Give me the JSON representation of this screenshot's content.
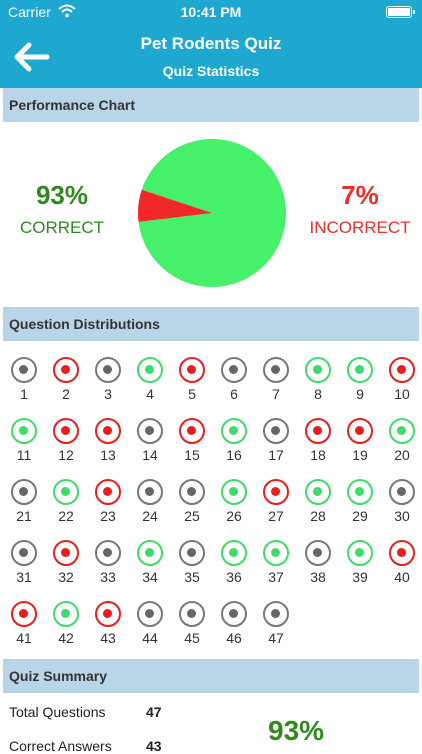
{
  "status_bar": {
    "carrier": "Carrier",
    "time": "10:41 PM"
  },
  "nav": {
    "title": "Pet Rodents Quiz",
    "subtitle": "Quiz Statistics",
    "back_icon": "back-arrow-icon"
  },
  "colors": {
    "header": "#1ea7cf",
    "section": "#b9d5e8",
    "correct": "#3ddc6a",
    "incorrect": "#e81d1d",
    "unanswered": "#777777",
    "correct_text": "#2e8a1e",
    "incorrect_text": "#e8302a"
  },
  "performance": {
    "header": "Performance Chart",
    "correct_pct": "93%",
    "correct_label": "CORRECT",
    "incorrect_pct": "7%",
    "incorrect_label": "INCORRECT"
  },
  "chart_data": {
    "type": "pie",
    "categories": [
      "Correct",
      "Incorrect"
    ],
    "values": [
      93,
      7
    ],
    "colors": [
      "#46f06b",
      "#f02828"
    ]
  },
  "distribution": {
    "header": "Question Distributions",
    "questions": [
      {
        "n": "1",
        "state": "unanswered"
      },
      {
        "n": "2",
        "state": "incorrect"
      },
      {
        "n": "3",
        "state": "unanswered"
      },
      {
        "n": "4",
        "state": "correct"
      },
      {
        "n": "5",
        "state": "incorrect"
      },
      {
        "n": "6",
        "state": "unanswered"
      },
      {
        "n": "7",
        "state": "unanswered"
      },
      {
        "n": "8",
        "state": "correct"
      },
      {
        "n": "9",
        "state": "correct"
      },
      {
        "n": "10",
        "state": "incorrect"
      },
      {
        "n": "11",
        "state": "correct"
      },
      {
        "n": "12",
        "state": "incorrect"
      },
      {
        "n": "13",
        "state": "incorrect"
      },
      {
        "n": "14",
        "state": "unanswered"
      },
      {
        "n": "15",
        "state": "incorrect"
      },
      {
        "n": "16",
        "state": "correct"
      },
      {
        "n": "17",
        "state": "unanswered"
      },
      {
        "n": "18",
        "state": "incorrect"
      },
      {
        "n": "19",
        "state": "incorrect"
      },
      {
        "n": "20",
        "state": "correct"
      },
      {
        "n": "21",
        "state": "unanswered"
      },
      {
        "n": "22",
        "state": "correct"
      },
      {
        "n": "23",
        "state": "incorrect"
      },
      {
        "n": "24",
        "state": "unanswered"
      },
      {
        "n": "25",
        "state": "unanswered"
      },
      {
        "n": "26",
        "state": "correct"
      },
      {
        "n": "27",
        "state": "incorrect"
      },
      {
        "n": "28",
        "state": "correct"
      },
      {
        "n": "29",
        "state": "correct"
      },
      {
        "n": "30",
        "state": "unanswered"
      },
      {
        "n": "31",
        "state": "unanswered"
      },
      {
        "n": "32",
        "state": "incorrect"
      },
      {
        "n": "33",
        "state": "unanswered"
      },
      {
        "n": "34",
        "state": "correct"
      },
      {
        "n": "35",
        "state": "unanswered"
      },
      {
        "n": "36",
        "state": "correct"
      },
      {
        "n": "37",
        "state": "correct"
      },
      {
        "n": "38",
        "state": "unanswered"
      },
      {
        "n": "39",
        "state": "correct"
      },
      {
        "n": "40",
        "state": "incorrect"
      },
      {
        "n": "41",
        "state": "incorrect"
      },
      {
        "n": "42",
        "state": "correct"
      },
      {
        "n": "43",
        "state": "incorrect"
      },
      {
        "n": "44",
        "state": "unanswered"
      },
      {
        "n": "45",
        "state": "unanswered"
      },
      {
        "n": "46",
        "state": "unanswered"
      },
      {
        "n": "47",
        "state": "unanswered"
      }
    ]
  },
  "summary": {
    "header": "Quiz Summary",
    "rows": [
      {
        "label": "Total Questions",
        "value": "47"
      },
      {
        "label": "Correct Answers",
        "value": "43"
      }
    ],
    "score_pct": "93%"
  }
}
